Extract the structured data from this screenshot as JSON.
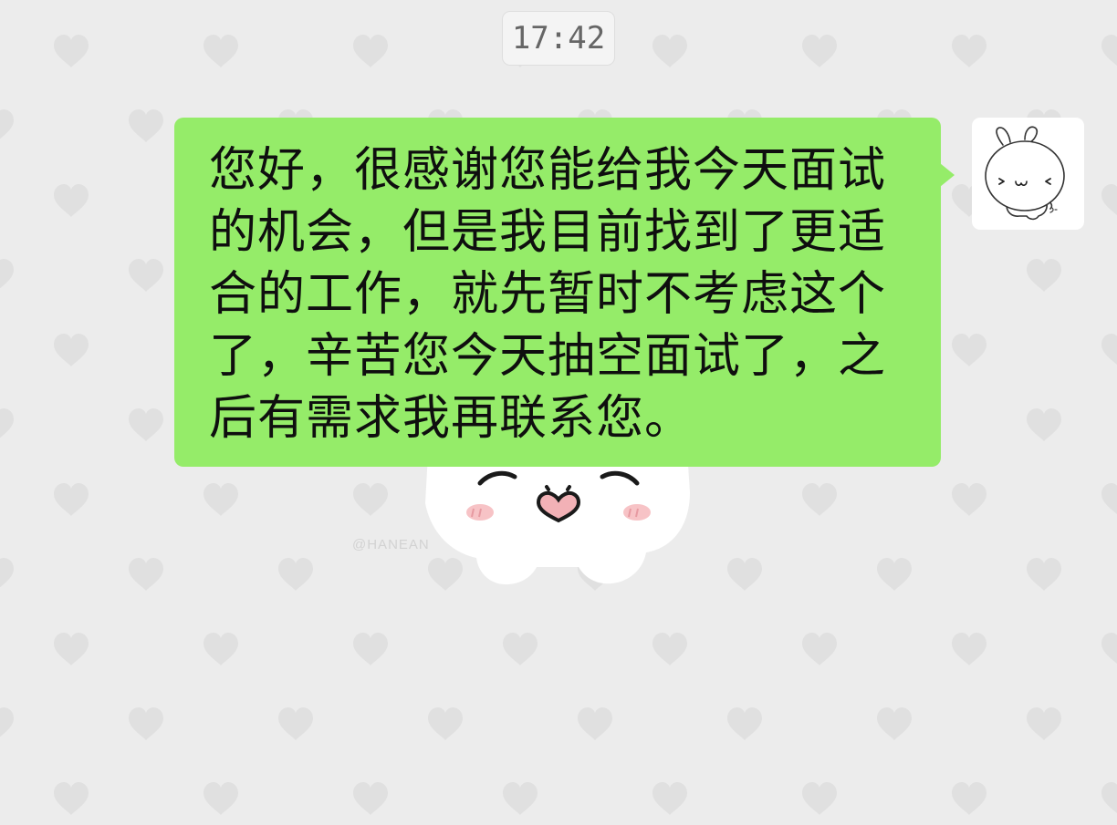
{
  "chat": {
    "timestamp": "17:42",
    "messages": [
      {
        "direction": "outgoing",
        "text": "您好，很感谢您能给我今天面试的机会，但是我目前找到了更适合的工作，就先暂时不考虑这个了，辛苦您今天抽空面试了，之后有需求我再联系您。",
        "avatar_icon": "bunny-avatar-icon"
      }
    ]
  },
  "wallpaper": {
    "pattern_icon": "heart-icon",
    "character_icon": "bunny-character-icon",
    "watermark": "@HANEAN"
  },
  "colors": {
    "background": "#ececec",
    "heart": "#e0e0e0",
    "outgoing_bubble": "#95ec69",
    "message_text": "#0f0f0f",
    "timestamp_bg": "#f4f4f4",
    "timestamp_text": "#666666",
    "cheek_blush": "#f7c3c6",
    "nose": "#f2b1b6"
  }
}
